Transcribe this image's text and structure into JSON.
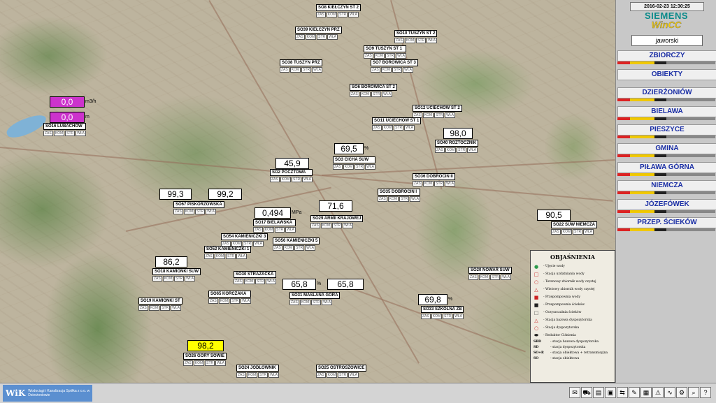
{
  "header": {
    "datetime": "2016-02-23 12:30:25",
    "brand_line1": "SIEMENS",
    "brand_line2": "WinCC",
    "user": "jaworski"
  },
  "nav": [
    {
      "label": "ZBIORCZY",
      "icon": "status-bar"
    },
    {
      "label": "OBIEKTY",
      "icon": "none"
    },
    {
      "label": "DZIERŻONIÓW",
      "icon": "status-bar"
    },
    {
      "label": "BIELAWA",
      "icon": "status-bar"
    },
    {
      "label": "PIESZYCE",
      "icon": "status-bar"
    },
    {
      "label": "GMINA",
      "icon": "status-bar"
    },
    {
      "label": "PIŁAWA GÓRNA",
      "icon": "status-bar"
    },
    {
      "label": "NIEMCZA",
      "icon": "status-bar"
    },
    {
      "label": "JÓZEFÓWEK",
      "icon": "status-bar"
    },
    {
      "label": "PRZEP. ŚCIEKÓW",
      "icon": "status-bar"
    }
  ],
  "codes": [
    "ZAS",
    "KOM",
    "STR",
    "WŁA"
  ],
  "stations": [
    {
      "name": "SO8 KIEŁCZYN ST 2"
    },
    {
      "name": "SO39 KIEŁCZYN PRZ"
    },
    {
      "name": "SO10 TUSZYN ST 2"
    },
    {
      "name": "SO9 TUSZYN ST 1"
    },
    {
      "name": "SO38 TUSZYN PRZ"
    },
    {
      "name": "SO7 BOROWICA ST 3"
    },
    {
      "name": "SO6 BOROWICA ST 2"
    },
    {
      "name": "SO12 UCIECHÓW ST 2"
    },
    {
      "name": "SO11 UCIECHÓW ST 1"
    },
    {
      "name": "SO16 LUBACHÓW"
    },
    {
      "name": "SO40 ROZTOCZNIK"
    },
    {
      "name": "SO3 CICHA SUW"
    },
    {
      "name": "SO2 POCZTOWA"
    },
    {
      "name": "SO36 DOBROCIN II"
    },
    {
      "name": "SO35 DOBROCIN I"
    },
    {
      "name": "SO67 PISKORZOWSKA"
    },
    {
      "name": "SO17 BIELAWSKA"
    },
    {
      "name": "SO29 ARMII KRAJOWEJ"
    },
    {
      "name": "SO22 SUW NIEMCZA"
    },
    {
      "name": "SO54 KAMIENICZKI 3"
    },
    {
      "name": "SO56 KAMIENICZKI 5"
    },
    {
      "name": "SO52 KAMIENICZKI 1"
    },
    {
      "name": "SO18 KAMIONKI SUW"
    },
    {
      "name": "SO30 STRAŻACKA"
    },
    {
      "name": "SO20 NOWAR SUW"
    },
    {
      "name": "SO65 KORCZAKA"
    },
    {
      "name": "SO31 MAŚLANA GÓRA"
    },
    {
      "name": "SO19 KAMIONKI ST"
    },
    {
      "name": "SO33 SZKOLNA ZB"
    },
    {
      "name": "SO26 GÓRY SOWIE"
    },
    {
      "name": "SO24 JODŁOWNIK"
    },
    {
      "name": "SO25 OSTROSZOWICE"
    }
  ],
  "values": [
    {
      "id": "lubachow-1",
      "value": "0,0",
      "unit": "m3/h"
    },
    {
      "id": "lubachow-2",
      "value": "0,0",
      "unit": "m"
    },
    {
      "id": "roztocznik",
      "value": "98,0",
      "unit": ""
    },
    {
      "id": "cicha",
      "value": "69,5",
      "unit": "%"
    },
    {
      "id": "pocztowa",
      "value": "45,9",
      "unit": ""
    },
    {
      "id": "piskorzowska-1",
      "value": "99,3",
      "unit": ""
    },
    {
      "id": "piskorzowska-2",
      "value": "99,2",
      "unit": ""
    },
    {
      "id": "bielawska",
      "value": "0,494",
      "unit": "MPa"
    },
    {
      "id": "armii",
      "value": "71,6",
      "unit": ""
    },
    {
      "id": "niemcza",
      "value": "90,5",
      "unit": ""
    },
    {
      "id": "kamionki",
      "value": "86,2",
      "unit": ""
    },
    {
      "id": "maslana-1",
      "value": "65,8",
      "unit": "%"
    },
    {
      "id": "maslana-2",
      "value": "65,8",
      "unit": ""
    },
    {
      "id": "szkolna",
      "value": "69,8",
      "unit": "%"
    },
    {
      "id": "gory-sowie",
      "value": "98,2",
      "unit": ""
    }
  ],
  "legend": {
    "title": "OBJAŚNIENIA",
    "items": [
      {
        "label": "- Ujęcie wody",
        "icon": "green-circle-icon"
      },
      {
        "label": "- Stacja uzdatniania wody",
        "icon": "red-square-icon"
      },
      {
        "label": "- Terenowy zbiornik wody czystej",
        "icon": "red-circle-icon"
      },
      {
        "label": "- Wieżowy zbiornik wody czystej",
        "icon": "red-triangle-icon"
      },
      {
        "label": "- Przepompownia wody",
        "icon": "red-filled-square-icon"
      },
      {
        "label": "- Przepompownia ścieków",
        "icon": "black-square-icon"
      },
      {
        "label": "- Oczyszczalnia ścieków",
        "icon": "gray-square-icon"
      },
      {
        "label": "- Stacja bazowa dyspozytorska",
        "icon": "red-triangle-icon"
      },
      {
        "label": "- Stacja dyspozytorska",
        "icon": "red-circle-icon"
      },
      {
        "label": "- Reduktor Ciśnienia",
        "icon": "reducer-icon"
      }
    ],
    "abbreviations": [
      {
        "code": "SBD",
        "label": "- stacja bazowa dyspozytorska"
      },
      {
        "code": "SD",
        "label": "- stacja dyspozytorska"
      },
      {
        "code": "SO+R",
        "label": "- stacja obiektowa + retransmisyjna"
      },
      {
        "code": "SO",
        "label": "- stacja obiektowa"
      }
    ]
  },
  "footer": {
    "logo": "WiK",
    "company": "Wodociągi i Kanalizacja Spółka z o.o. w Dzierżoniowie"
  }
}
